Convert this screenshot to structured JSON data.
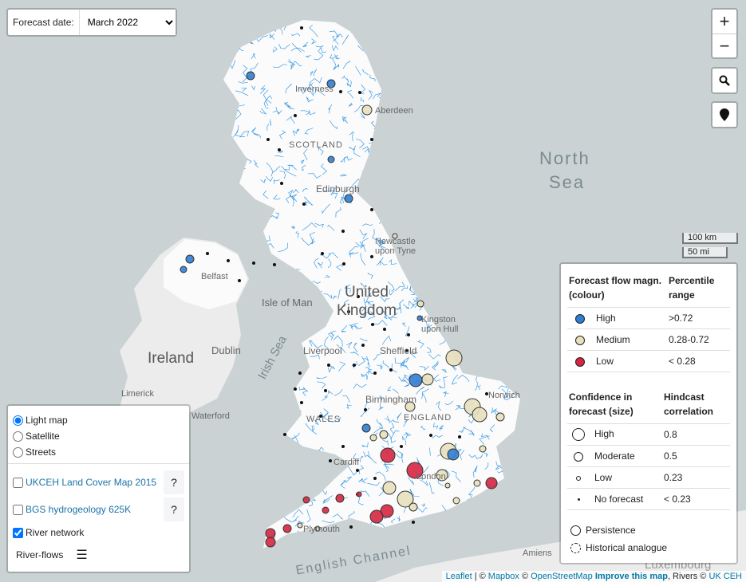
{
  "forecast": {
    "label": "Forecast date:",
    "selected": "March 2022"
  },
  "zoom": {
    "in": "+",
    "out": "−"
  },
  "tools": {
    "search_icon": "search-icon",
    "locate_icon": "map-marker-icon"
  },
  "scale": {
    "km": "100 km",
    "mi": "50 mi"
  },
  "legend": {
    "magn_header": "Forecast flow magn. (colour)",
    "range_header": "Percentile range",
    "magn": [
      {
        "label": "High",
        "range": ">0.72",
        "color": "#2f7ed3"
      },
      {
        "label": "Medium",
        "range": "0.28-0.72",
        "color": "#e8e0bc"
      },
      {
        "label": "Low",
        "range": "< 0.28",
        "color": "#d42640"
      }
    ],
    "conf_header": "Confidence in forecast (size)",
    "corr_header": "Hindcast correlation",
    "conf": [
      {
        "label": "High",
        "value": "0.8"
      },
      {
        "label": "Moderate",
        "value": "0.5"
      },
      {
        "label": "Low",
        "value": "0.23"
      },
      {
        "label": "No forecast",
        "value": "< 0.23"
      }
    ],
    "persistence": "Persistence",
    "analogue": "Historical analogue"
  },
  "layers": {
    "base": [
      {
        "label": "Light map",
        "checked": true
      },
      {
        "label": "Satellite",
        "checked": false
      },
      {
        "label": "Streets",
        "checked": false
      }
    ],
    "overlays": [
      {
        "label": "UKCEH Land Cover Map 2015",
        "checked": false,
        "help": "?"
      },
      {
        "label": "BGS hydrogeology 625K",
        "checked": false,
        "help": "?"
      },
      {
        "label": "River network",
        "checked": true
      }
    ],
    "riverflows": "River-flows"
  },
  "attribution": {
    "leaflet": "Leaflet",
    "sep1": " | © ",
    "mapbox": "Mapbox",
    "sep2": " © ",
    "osm": "OpenStreetMap",
    "improve": "Improve this map",
    "rivers": ", Rivers © ",
    "ukceh": "UK CEH"
  },
  "map_labels": {
    "north_sea_1": "North",
    "north_sea_2": "Sea",
    "uk_1": "United",
    "uk_2": "Kingdom",
    "ireland": "Ireland",
    "isle_of_man": "Isle of Man",
    "irish_sea": "Irish Sea",
    "dublin": "Dublin",
    "english_channel": "English Channel",
    "scotland": "SCOTLAND",
    "england": "ENGLAND",
    "wales": "WALES",
    "edinburgh": "Edinburgh",
    "liverpool": "Liverpool",
    "sheffield": "Sheffield",
    "newcastle": "Newcastle upon Tyne",
    "hull": "Kingston upon Hull",
    "birmingham": "Birmingham",
    "norwich": "Norwich",
    "london": "London",
    "aberdeen": "Aberdeen",
    "inverness": "Inverness",
    "belfast": "Belfast",
    "limerick": "Limerick",
    "waterford": "Waterford",
    "cardiff": "Cardiff",
    "plymouth": "Plymouth",
    "amiens": "Amiens",
    "luxembourg": "Luxembourg"
  }
}
